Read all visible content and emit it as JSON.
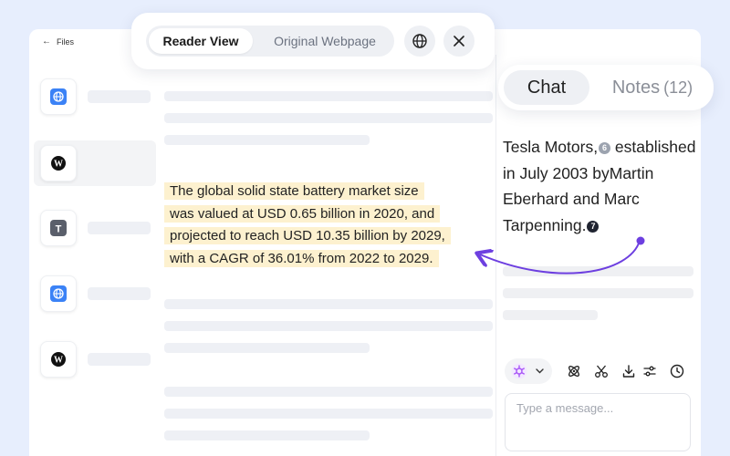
{
  "files_header": {
    "back_icon": "arrow-left-icon",
    "label": "Files"
  },
  "sidebar": {
    "items": [
      {
        "icon": "globe-icon",
        "icon_color": "#3b82f6"
      },
      {
        "icon": "w-logo-icon",
        "icon_color": "#111111",
        "selected": true
      },
      {
        "icon": "t-text-icon",
        "icon_color": "#5a5f6b"
      },
      {
        "icon": "globe-icon",
        "icon_color": "#3b82f6"
      },
      {
        "icon": "w-logo-icon",
        "icon_color": "#111111"
      }
    ]
  },
  "view_toggle": {
    "reader_label": "Reader View",
    "original_label": "Original Webpage",
    "active": "reader"
  },
  "topbar_actions": {
    "globe": "globe-icon",
    "close": "close-icon"
  },
  "document": {
    "highlight_lines": [
      "The global solid state battery market size",
      "was valued at USD 0.65 billion in 2020, and",
      "projected to reach USD 10.35 billion by 2029,",
      "with a CAGR of 36.01% from 2022 to 2029."
    ],
    "highlight_color": "#fdf1cf"
  },
  "panel_tabs": {
    "chat_label": "Chat",
    "notes_label": "Notes",
    "notes_count": "(12)",
    "active": "chat"
  },
  "chat": {
    "answer_part1": "Tesla Motors,",
    "cite1": "6",
    "answer_part2": " established in July 2003 byMartin Eberhard and Marc Tarpenning.",
    "cite2": "7",
    "link_color": "#6d3fe0"
  },
  "chat_toolbar": {
    "model_icon": "openai-logo-icon",
    "model_icon_color": "#a855f7",
    "icons": [
      "atom-icon",
      "scissors-icon",
      "download-icon",
      "sliders-icon",
      "clock-icon"
    ]
  },
  "message_input": {
    "placeholder": "Type a message..."
  }
}
